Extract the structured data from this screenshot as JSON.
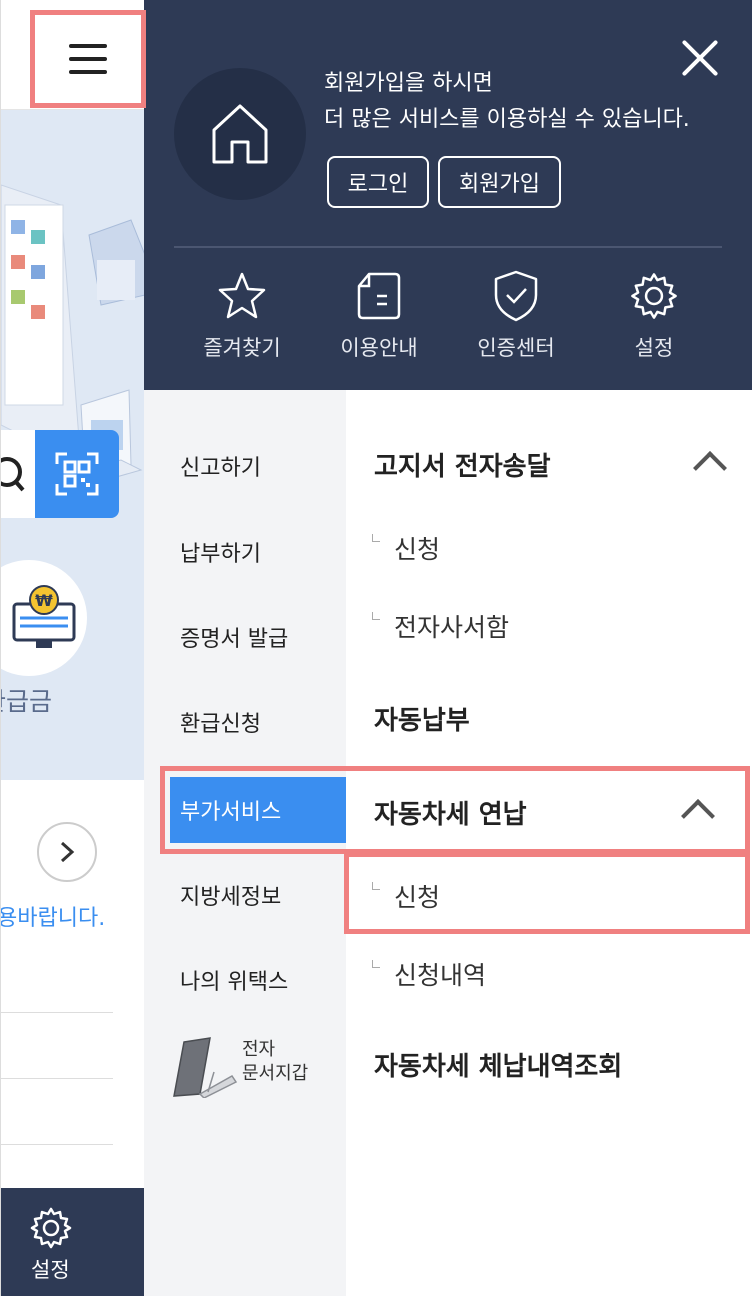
{
  "background_page": {
    "refund_label": "환급금",
    "notice_text": "용바랍니다.",
    "bottom_nav_label": "설정"
  },
  "drawer": {
    "welcome_line1": "회원가입을 하시면",
    "welcome_line2": "더 많은 서비스를 이용하실 수 있습니다.",
    "login_label": "로그인",
    "join_label": "회원가입",
    "quick_menu": [
      {
        "label": "즐겨찾기",
        "icon": "star-icon"
      },
      {
        "label": "이용안내",
        "icon": "document-icon"
      },
      {
        "label": "인증센터",
        "icon": "shield-icon"
      },
      {
        "label": "설정",
        "icon": "gear-icon"
      }
    ],
    "nav_left": [
      {
        "label": "신고하기"
      },
      {
        "label": "납부하기"
      },
      {
        "label": "증명서 발급"
      },
      {
        "label": "환급신청"
      },
      {
        "label": "부가서비스",
        "active": true
      },
      {
        "label": "지방세정보"
      },
      {
        "label": "나의 위택스"
      }
    ],
    "wallet_text_line1": "전자",
    "wallet_text_line2": "문서지갑",
    "nav_right": [
      {
        "title": "고지서 전자송달",
        "expanded": true,
        "children": [
          "신청",
          "전자사서함"
        ]
      },
      {
        "title": "자동납부",
        "expanded": false,
        "children": []
      },
      {
        "title": "자동차세 연납",
        "expanded": true,
        "children": [
          "신청",
          "신청내역"
        ]
      },
      {
        "title": "자동차세 체납내역조회",
        "expanded": false,
        "children": []
      }
    ]
  },
  "colors": {
    "drawer_dark": "#2e3a55",
    "accent_blue": "#3a8ef0",
    "highlight_red": "#f08080",
    "nav_left_bg": "#f3f4f6"
  }
}
